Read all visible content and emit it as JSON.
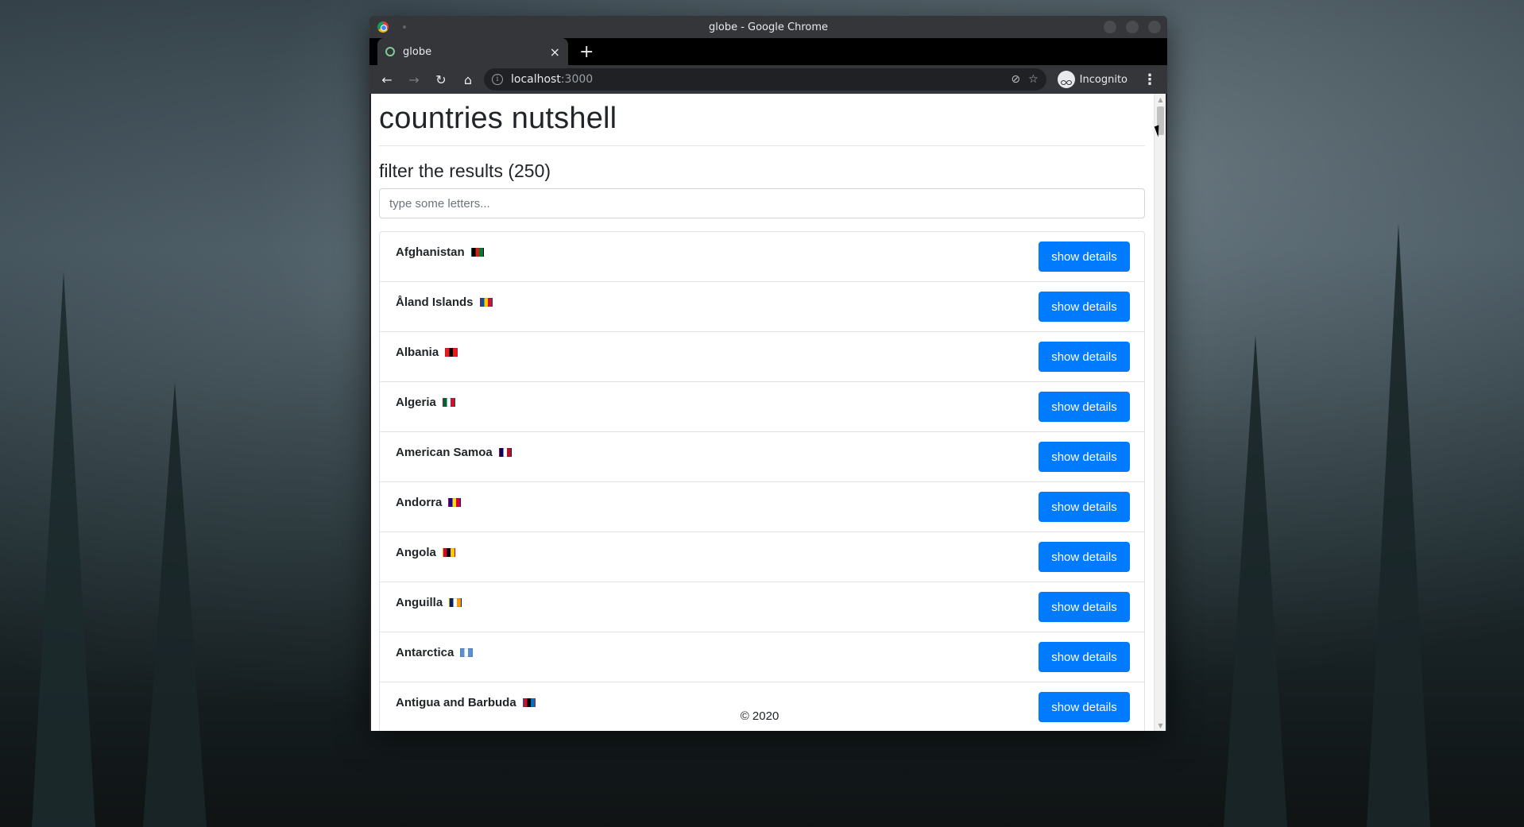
{
  "window": {
    "title": "globe - Google Chrome"
  },
  "tab": {
    "title": "globe",
    "close_glyph": "×",
    "new_tab_glyph": "+"
  },
  "toolbar": {
    "back_glyph": "←",
    "forward_glyph": "→",
    "reload_glyph": "↻",
    "home_glyph": "⌂",
    "url_host": "localhost",
    "url_port": ":3000",
    "eye_glyph": "⊘",
    "star_glyph": "☆",
    "profile_label": "Incognito",
    "menu_glyph": "⋮"
  },
  "page": {
    "title": "countries nutshell",
    "filter_label": "filter the results (250)",
    "filter_placeholder": "type some letters...",
    "filter_value": "",
    "details_label": "show details",
    "footer": "© 2020"
  },
  "countries": [
    {
      "name": "Afghanistan",
      "flag": [
        "#000000",
        "#d32011",
        "#007a36"
      ]
    },
    {
      "name": "Åland Islands",
      "flag": [
        "#0053a5",
        "#ffce00",
        "#d21034"
      ]
    },
    {
      "name": "Albania",
      "flag": [
        "#e41e20",
        "#000000",
        "#e41e20"
      ]
    },
    {
      "name": "Algeria",
      "flag": [
        "#006233",
        "#ffffff",
        "#d21034"
      ]
    },
    {
      "name": "American Samoa",
      "flag": [
        "#000066",
        "#ffffff",
        "#bd1021"
      ]
    },
    {
      "name": "Andorra",
      "flag": [
        "#10069f",
        "#fedd00",
        "#d50032"
      ]
    },
    {
      "name": "Angola",
      "flag": [
        "#cc092f",
        "#000000",
        "#ffcb00"
      ]
    },
    {
      "name": "Anguilla",
      "flag": [
        "#012169",
        "#ffffff",
        "#ff9900"
      ]
    },
    {
      "name": "Antarctica",
      "flag": [
        "#5a8fd1",
        "#ffffff",
        "#5a8fd1"
      ]
    },
    {
      "name": "Antigua and Barbuda",
      "flag": [
        "#ce1126",
        "#000000",
        "#0072c6"
      ]
    }
  ]
}
